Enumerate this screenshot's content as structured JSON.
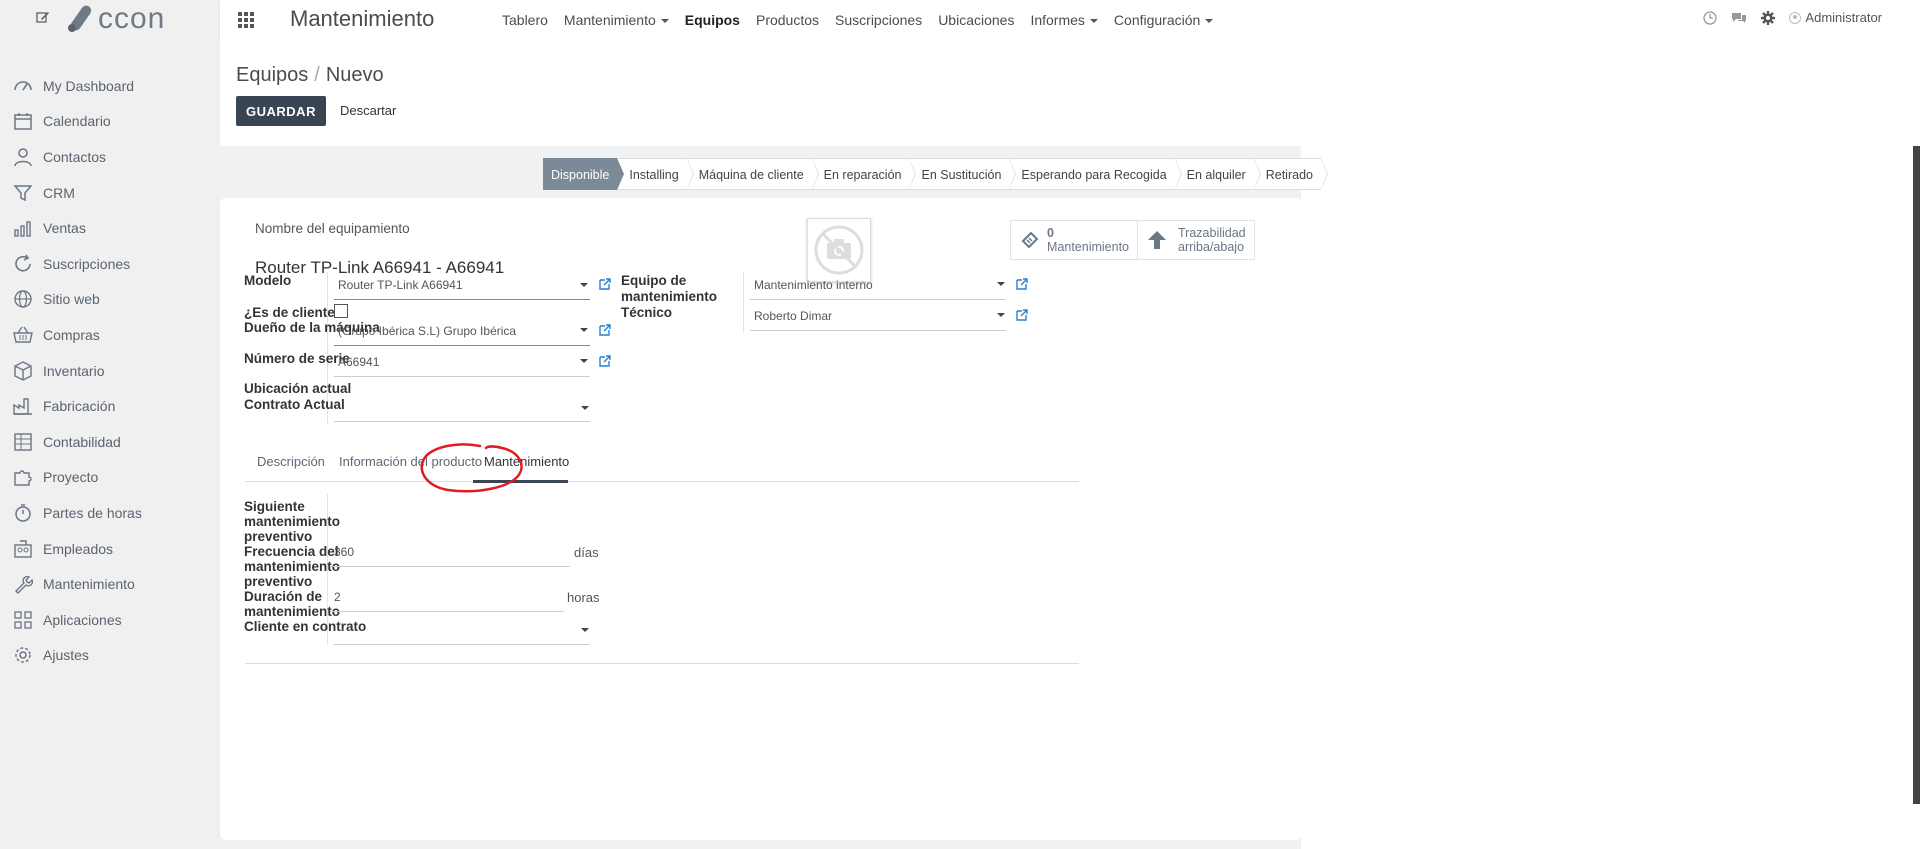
{
  "sidebar": {
    "logo_text": "ccon",
    "items": [
      {
        "label": "My Dashboard",
        "icon": "dashboard-icon"
      },
      {
        "label": "Calendario",
        "icon": "calendar-icon"
      },
      {
        "label": "Contactos",
        "icon": "person-icon"
      },
      {
        "label": "CRM",
        "icon": "filter-icon"
      },
      {
        "label": "Ventas",
        "icon": "bar-chart-icon"
      },
      {
        "label": "Suscripciones",
        "icon": "refresh-icon"
      },
      {
        "label": "Sitio web",
        "icon": "globe-icon"
      },
      {
        "label": "Compras",
        "icon": "basket-icon"
      },
      {
        "label": "Inventario",
        "icon": "box-icon"
      },
      {
        "label": "Fabricación",
        "icon": "factory-icon"
      },
      {
        "label": "Contabilidad",
        "icon": "ledger-icon"
      },
      {
        "label": "Proyecto",
        "icon": "puzzle-icon"
      },
      {
        "label": "Partes de horas",
        "icon": "stopwatch-icon"
      },
      {
        "label": "Empleados",
        "icon": "employees-icon"
      },
      {
        "label": "Mantenimiento",
        "icon": "wrench-icon"
      },
      {
        "label": "Aplicaciones",
        "icon": "apps-grid-icon"
      },
      {
        "label": "Ajustes",
        "icon": "gear-icon"
      }
    ]
  },
  "topbar": {
    "app_title": "Mantenimiento",
    "nav": [
      {
        "label": "Tablero",
        "dropdown": false,
        "active": false
      },
      {
        "label": "Mantenimiento",
        "dropdown": true,
        "active": false
      },
      {
        "label": "Equipos",
        "dropdown": false,
        "active": true
      },
      {
        "label": "Productos",
        "dropdown": false,
        "active": false
      },
      {
        "label": "Suscripciones",
        "dropdown": false,
        "active": false
      },
      {
        "label": "Ubicaciones",
        "dropdown": false,
        "active": false
      },
      {
        "label": "Informes",
        "dropdown": true,
        "active": false
      },
      {
        "label": "Configuración",
        "dropdown": true,
        "active": false
      }
    ],
    "user": "Administrator"
  },
  "control_panel": {
    "breadcrumb_parent": "Equipos",
    "breadcrumb_separator": "/",
    "breadcrumb_current": "Nuevo",
    "save_label": "GUARDAR",
    "discard_label": "Descartar"
  },
  "statusbar": {
    "stages": [
      "Disponible",
      "Installing",
      "Máquina de cliente",
      "En reparación",
      "En Sustitución",
      "Esperando para Recogida",
      "En alquiler",
      "Retirado"
    ],
    "active": "Disponible"
  },
  "form": {
    "name_label": "Nombre del equipamiento",
    "name_value": "Router TP-Link A66941 - A66941",
    "smart_buttons": {
      "maintenance_count": "0",
      "maintenance_label": "Mantenimiento",
      "trace_line1": "Trazabilidad",
      "trace_line2": "arriba/abajo"
    },
    "left_fields": {
      "modelo_label": "Modelo",
      "modelo_value": "Router TP-Link A66941",
      "es_cliente_label": "¿Es de cliente?",
      "dueno_label": "Dueño de la máquina",
      "dueno_value": "(Grupo Ibérica  S.L) Grupo Ibérica",
      "serie_label": "Número de serie",
      "serie_value": "A66941",
      "ubicacion_label": "Ubicación actual",
      "contrato_label": "Contrato Actual",
      "contrato_value": ""
    },
    "right_fields": {
      "equipo_label_1": "Equipo de",
      "equipo_label_2": "mantenimiento",
      "equipo_value": "Mantenimiento interno",
      "tecnico_label": "Técnico",
      "tecnico_value": "Roberto Dimar"
    },
    "tabs": [
      "Descripción",
      "Información del producto",
      "Mantenimiento"
    ],
    "active_tab": "Mantenimiento",
    "maintenance": {
      "siguiente_label_1": "Siguiente",
      "siguiente_label_2": "mantenimiento",
      "siguiente_label_3": "preventivo",
      "frecuencia_label_1": "Frecuencia del",
      "frecuencia_label_2": "mantenimiento",
      "frecuencia_label_3": "preventivo",
      "frecuencia_value": "360",
      "frecuencia_unit": "días",
      "duracion_label_1": "Duración de",
      "duracion_label_2": "mantenimiento",
      "duracion_value": "2",
      "duracion_unit": "horas",
      "cliente_label": "Cliente en contrato",
      "cliente_value": ""
    }
  },
  "colors": {
    "sidebar_bg": "#f0f0f0",
    "primary_button": "#394553",
    "active_stage": "#7c8a97",
    "link_icon": "#2a7fd4",
    "annotation": "#e01b24"
  }
}
